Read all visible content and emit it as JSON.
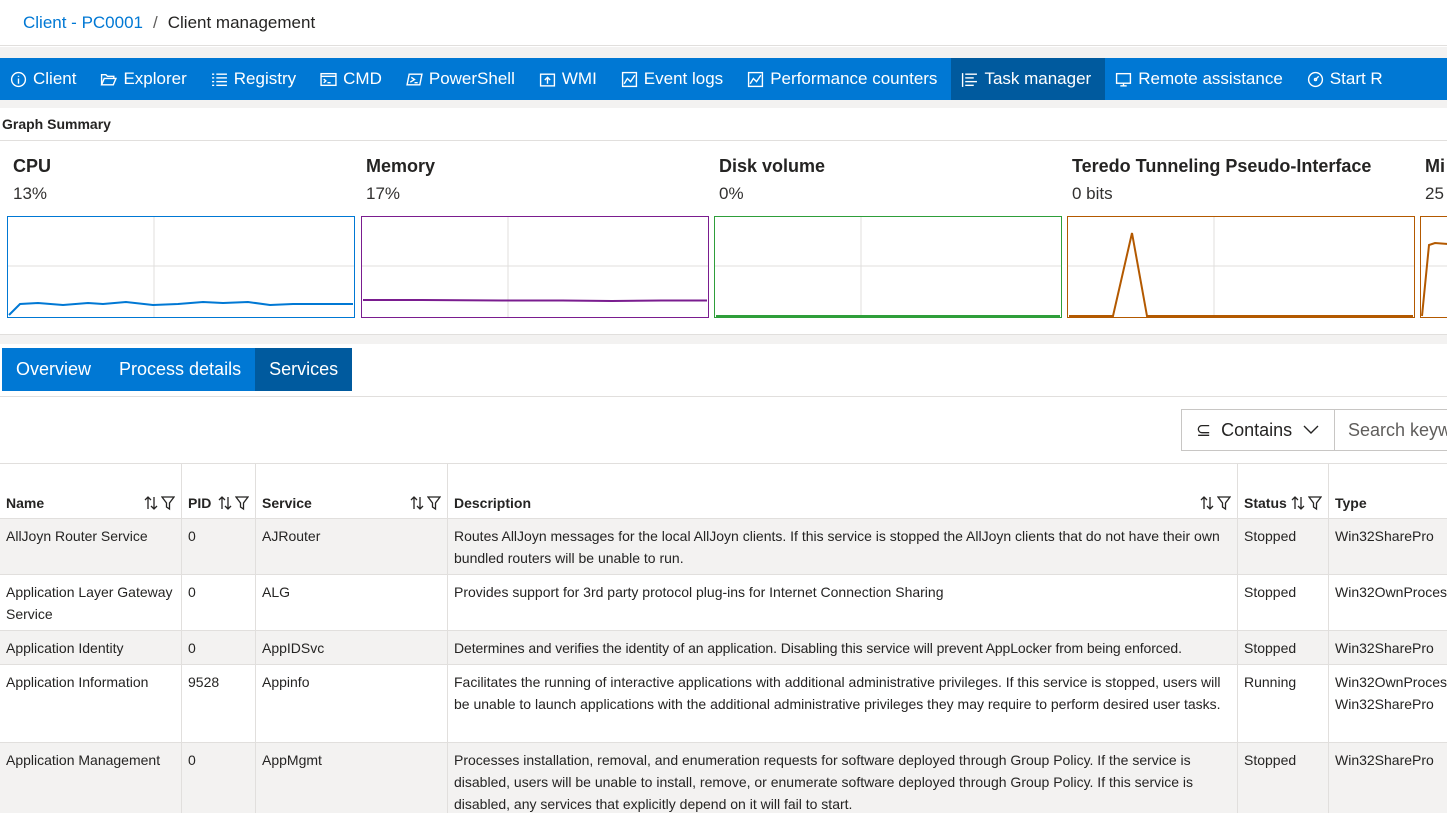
{
  "breadcrumb": {
    "client": "Client - PC0001",
    "separator": "/",
    "current": "Client management"
  },
  "nav": [
    {
      "label": "Client",
      "icon": "info-icon"
    },
    {
      "label": "Explorer",
      "icon": "folder-icon"
    },
    {
      "label": "Registry",
      "icon": "list-icon"
    },
    {
      "label": "CMD",
      "icon": "cmd-icon"
    },
    {
      "label": "PowerShell",
      "icon": "powershell-icon"
    },
    {
      "label": "WMI",
      "icon": "wmi-icon"
    },
    {
      "label": "Event logs",
      "icon": "chart-icon"
    },
    {
      "label": "Performance counters",
      "icon": "chart-icon"
    },
    {
      "label": "Task manager",
      "icon": "task-list-icon",
      "active": true
    },
    {
      "label": "Remote assistance",
      "icon": "monitor-icon"
    },
    {
      "label": "Start R",
      "icon": "gauge-icon"
    }
  ],
  "graph_summary": {
    "title": "Graph Summary",
    "graphs": [
      {
        "name": "CPU",
        "value": "13%",
        "color": "#0078d4"
      },
      {
        "name": "Memory",
        "value": "17%",
        "color": "#7a1d8f"
      },
      {
        "name": "Disk volume",
        "value": "0%",
        "color": "#2e9e3a"
      },
      {
        "name": "Teredo Tunneling Pseudo-Interface",
        "value": "0 bits",
        "color": "#b35900"
      },
      {
        "name": "Mi",
        "value": "25",
        "color": "#b35900"
      }
    ]
  },
  "tabs": [
    {
      "label": "Overview"
    },
    {
      "label": "Process details"
    },
    {
      "label": "Services",
      "active": true
    }
  ],
  "filter": {
    "operator": "Contains",
    "search_placeholder": "Search keyw"
  },
  "table": {
    "columns": [
      "Name",
      "PID",
      "Service",
      "Description",
      "Status",
      "Type"
    ],
    "rows": [
      {
        "name": "AllJoyn Router Service",
        "pid": "0",
        "service": "AJRouter",
        "description": "Routes AllJoyn messages for the local AllJoyn clients. If this service is stopped the AllJoyn clients that do not have their own bundled routers will be unable to run.",
        "status": "Stopped",
        "type": "Win32SharePro"
      },
      {
        "name": "Application Layer Gateway Service",
        "pid": "0",
        "service": "ALG",
        "description": "Provides support for 3rd party protocol plug-ins for Internet Connection Sharing",
        "status": "Stopped",
        "type": "Win32OwnProces"
      },
      {
        "name": "Application Identity",
        "pid": "0",
        "service": "AppIDSvc",
        "description": "Determines and verifies the identity of an application. Disabling this service will prevent AppLocker from being enforced.",
        "status": "Stopped",
        "type": "Win32SharePro"
      },
      {
        "name": "Application Information",
        "pid": "9528",
        "service": "Appinfo",
        "description": "Facilitates the running of interactive applications with additional administrative privileges. If this service is stopped, users will be unable to launch applications with the additional administrative privileges they may require to perform desired user tasks.",
        "status": "Running",
        "type": "Win32OwnProces Win32SharePro"
      },
      {
        "name": "Application Management",
        "pid": "0",
        "service": "AppMgmt",
        "description": "Processes installation, removal, and enumeration requests for software deployed through Group Policy. If the service is disabled, users will be unable to install, remove, or enumerate software deployed through Group Policy. If this service is disabled, any services that explicitly depend on it will fail to start.",
        "status": "Stopped",
        "type": "Win32SharePro"
      }
    ]
  }
}
